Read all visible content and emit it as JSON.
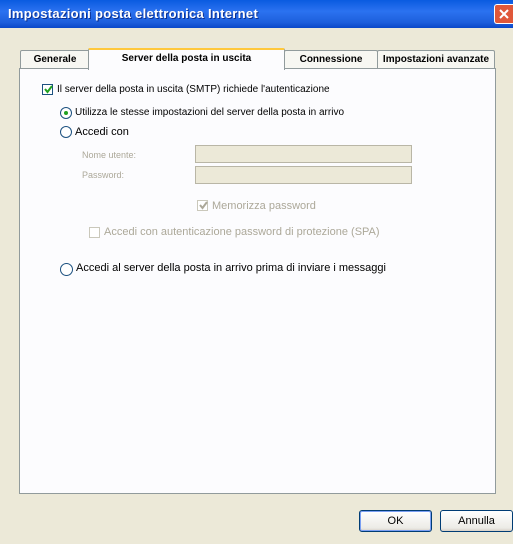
{
  "window": {
    "title": "Impostazioni posta elettronica Internet"
  },
  "tabs": [
    {
      "label": "Generale",
      "active": false
    },
    {
      "label": "Server della posta in uscita",
      "active": true
    },
    {
      "label": "Connessione",
      "active": false
    },
    {
      "label": "Impostazioni avanzate",
      "active": false
    }
  ],
  "outgoing": {
    "smtp_auth": {
      "label": "Il server della posta in uscita (SMTP) richiede l'autenticazione",
      "checked": true
    },
    "same_settings": {
      "label": "Utilizza le stesse impostazioni del server della posta in arrivo",
      "selected": true
    },
    "login_with": {
      "label": "Accedi con",
      "selected": false
    },
    "username": {
      "label": "Nome utente:",
      "value": ""
    },
    "password": {
      "label": "Password:",
      "value": ""
    },
    "remember_password": {
      "label": "Memorizza password",
      "checked": true
    },
    "spa": {
      "label": "Accedi con autenticazione password di protezione (SPA)",
      "checked": false
    },
    "login_incoming_first": {
      "label": "Accedi al server della posta in arrivo prima di inviare i messaggi",
      "selected": false
    }
  },
  "buttons": {
    "ok": "OK",
    "cancel": "Annulla"
  }
}
